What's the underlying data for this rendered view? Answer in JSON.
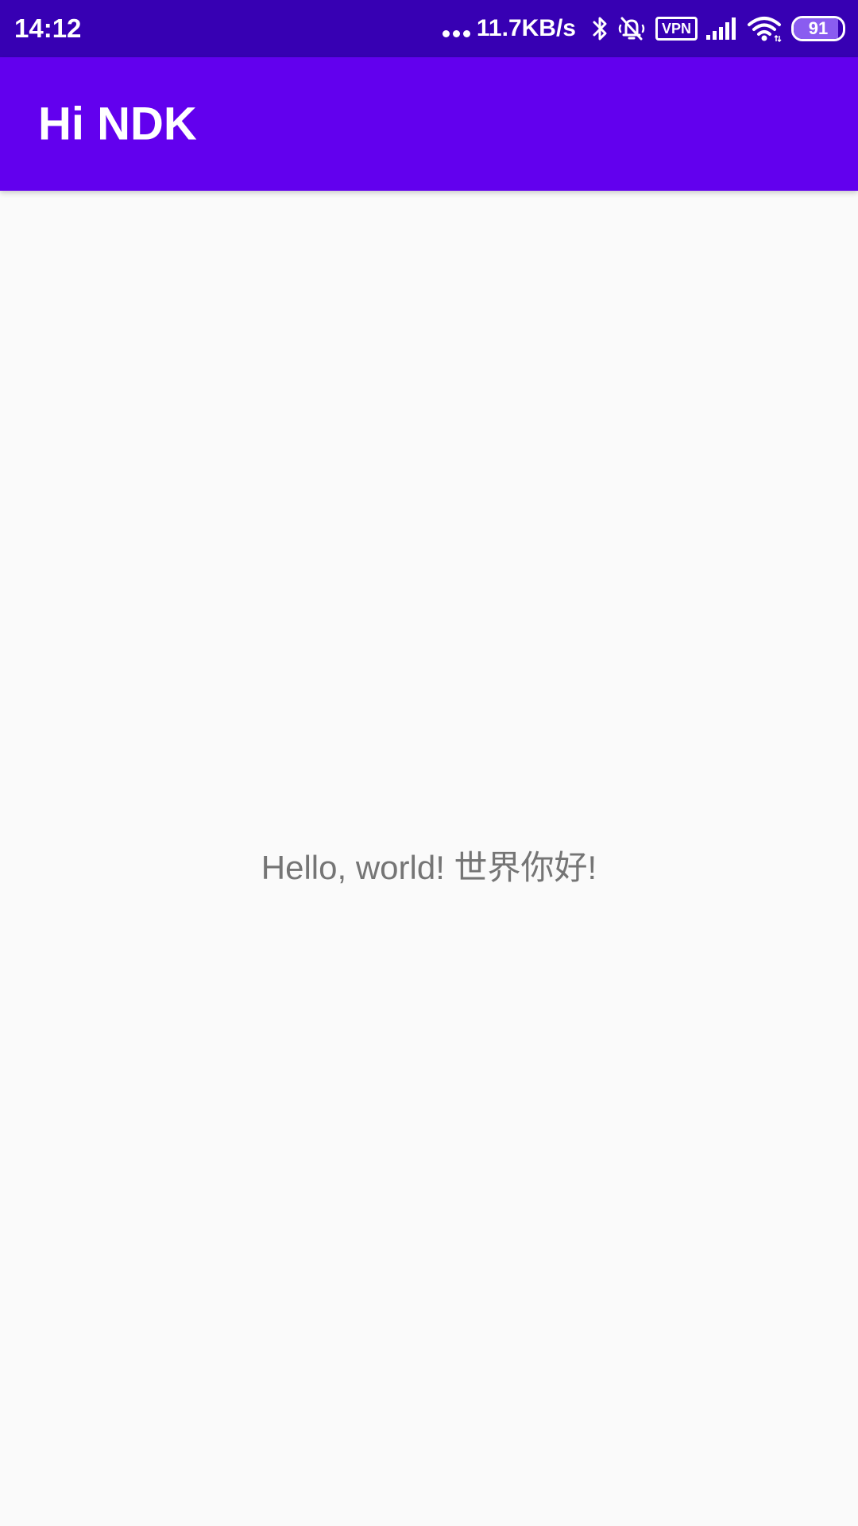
{
  "status_bar": {
    "time": "14:12",
    "net_speed": "11.7KB/s",
    "vpn_label": "VPN",
    "battery_percent": "91",
    "battery_level": 0.91,
    "icons": [
      "more-dots-icon",
      "bluetooth-icon",
      "mute-vibrate-icon",
      "vpn-icon",
      "signal-icon",
      "wifi-icon",
      "battery-icon"
    ],
    "background_color": "#3700b3"
  },
  "app_bar": {
    "title": "Hi NDK",
    "background_color": "#6200ee"
  },
  "main": {
    "message": "Hello, world! 世界你好!"
  }
}
